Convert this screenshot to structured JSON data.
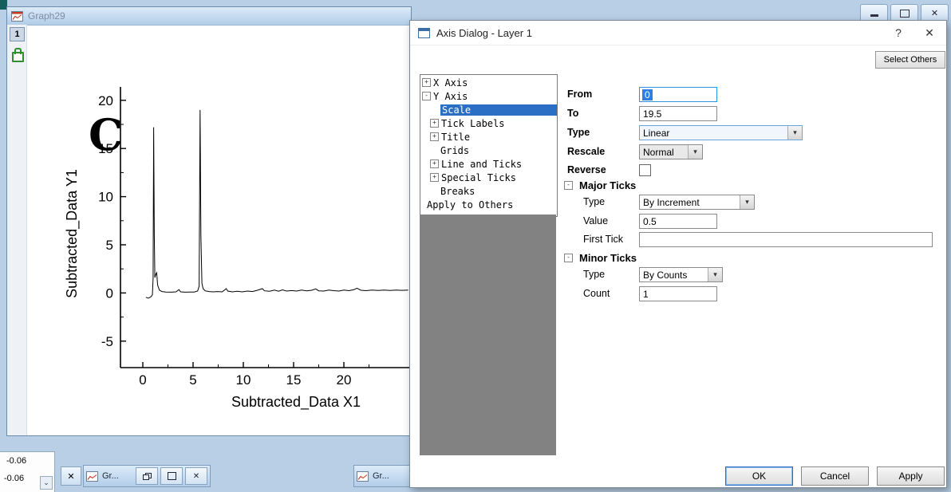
{
  "app": {
    "close_glyph": "✕"
  },
  "graph_window": {
    "title": "Graph29",
    "layer_tab": "1"
  },
  "chart_data": {
    "type": "line",
    "title": "",
    "xlabel": "Subtracted_Data X1",
    "ylabel": "Subtracted_Data Y1",
    "annotation": "C",
    "xticks": [
      0,
      5,
      10,
      15,
      20
    ],
    "yticks": [
      -5,
      0,
      5,
      10,
      15,
      20
    ],
    "xlim": [
      -2.2,
      26.6
    ],
    "ylim": [
      -7.7,
      21
    ],
    "grid": false,
    "legend": "none",
    "series": [
      {
        "name": "Subtracted_Data",
        "points": [
          [
            0.3,
            -0.45
          ],
          [
            0.55,
            -0.55
          ],
          [
            0.8,
            -0.4
          ],
          [
            0.95,
            -0.2
          ],
          [
            1.02,
            1.5
          ],
          [
            1.08,
            17.2
          ],
          [
            1.14,
            6
          ],
          [
            1.2,
            1.6
          ],
          [
            1.28,
            1.9
          ],
          [
            1.38,
            2.1
          ],
          [
            1.48,
            0.8
          ],
          [
            1.65,
            0.3
          ],
          [
            1.9,
            0.15
          ],
          [
            2.3,
            0.1
          ],
          [
            2.8,
            0.08
          ],
          [
            3.3,
            0.12
          ],
          [
            3.6,
            0.35
          ],
          [
            3.75,
            0.12
          ],
          [
            4.2,
            0.08
          ],
          [
            4.7,
            0.1
          ],
          [
            5.1,
            0.1
          ],
          [
            5.45,
            0.2
          ],
          [
            5.6,
            0.7
          ],
          [
            5.7,
            19
          ],
          [
            5.78,
            6
          ],
          [
            5.88,
            1
          ],
          [
            6,
            0.45
          ],
          [
            6.2,
            0.22
          ],
          [
            6.6,
            0.15
          ],
          [
            7,
            0.12
          ],
          [
            7.4,
            0.15
          ],
          [
            7.9,
            0.12
          ],
          [
            8.3,
            0.45
          ],
          [
            8.45,
            0.2
          ],
          [
            8.9,
            0.12
          ],
          [
            9.4,
            0.18
          ],
          [
            9.9,
            0.12
          ],
          [
            10.4,
            0.2
          ],
          [
            10.9,
            0.15
          ],
          [
            11.4,
            0.28
          ],
          [
            11.9,
            0.45
          ],
          [
            12.1,
            0.22
          ],
          [
            12.6,
            0.18
          ],
          [
            13.1,
            0.3
          ],
          [
            13.5,
            0.18
          ],
          [
            13.9,
            0.32
          ],
          [
            14.3,
            0.2
          ],
          [
            14.8,
            0.25
          ],
          [
            15.3,
            0.2
          ],
          [
            15.8,
            0.3
          ],
          [
            16.3,
            0.22
          ],
          [
            16.8,
            0.28
          ],
          [
            17.2,
            0.42
          ],
          [
            17.5,
            0.22
          ],
          [
            18,
            0.2
          ],
          [
            18.5,
            0.3
          ],
          [
            19,
            0.24
          ],
          [
            19.5,
            0.2
          ],
          [
            20,
            0.3
          ],
          [
            20.5,
            0.24
          ],
          [
            21,
            0.34
          ],
          [
            21.3,
            0.5
          ],
          [
            21.7,
            0.28
          ],
          [
            22.2,
            0.24
          ],
          [
            22.8,
            0.3
          ],
          [
            23.4,
            0.26
          ],
          [
            24,
            0.3
          ],
          [
            24.6,
            0.26
          ],
          [
            25.2,
            0.3
          ],
          [
            25.8,
            0.27
          ],
          [
            26.4,
            0.3
          ]
        ]
      }
    ]
  },
  "dialog": {
    "title": "Axis Dialog - Layer 1",
    "help_label": "?",
    "close_label": "✕",
    "select_others_label": "Select Others",
    "tree": {
      "items": [
        {
          "label": "X Axis",
          "glyph": "+",
          "level": 0,
          "selected": false
        },
        {
          "label": "Y Axis",
          "glyph": "-",
          "level": 0,
          "selected": false
        },
        {
          "label": "Scale",
          "glyph": "",
          "level": 1,
          "selected": true
        },
        {
          "label": "Tick Labels",
          "glyph": "+",
          "level": 1,
          "selected": false
        },
        {
          "label": "Title",
          "glyph": "+",
          "level": 1,
          "selected": false
        },
        {
          "label": "Grids",
          "glyph": "",
          "level": 1,
          "selected": false
        },
        {
          "label": "Line and Ticks",
          "glyph": "+",
          "level": 1,
          "selected": false
        },
        {
          "label": "Special Ticks",
          "glyph": "+",
          "level": 1,
          "selected": false
        },
        {
          "label": "Breaks",
          "glyph": "",
          "level": 1,
          "selected": false
        },
        {
          "label": "Apply to Others",
          "glyph": "",
          "level": 0,
          "selected": false
        }
      ]
    },
    "form": {
      "from_label": "From",
      "from_value": "0",
      "to_label": "To",
      "to_value": "19.5",
      "type_label": "Type",
      "type_value": "Linear",
      "rescale_label": "Rescale",
      "rescale_value": "Normal",
      "reverse_label": "Reverse",
      "major_header": "Major Ticks",
      "major_glyph": "-",
      "major_type_label": "Type",
      "major_type_value": "By Increment",
      "major_value_label": "Value",
      "major_value_value": "0.5",
      "first_tick_label": "First Tick",
      "first_tick_value": "",
      "minor_header": "Minor Ticks",
      "minor_glyph": "-",
      "minor_type_label": "Type",
      "minor_type_value": "By Counts",
      "minor_count_label": "Count",
      "minor_count_value": "1"
    },
    "footer": {
      "ok": "OK",
      "cancel": "Cancel",
      "apply": "Apply"
    }
  },
  "bottom": {
    "value_rows": {
      "row1": "-0.06",
      "row2": "-0.06"
    },
    "scroll_down_glyph": "⌄",
    "min_window_1_label": "Gr...",
    "min_window_2_label": "Gr..."
  },
  "ui": {
    "dropdown_arrow": "▾"
  }
}
